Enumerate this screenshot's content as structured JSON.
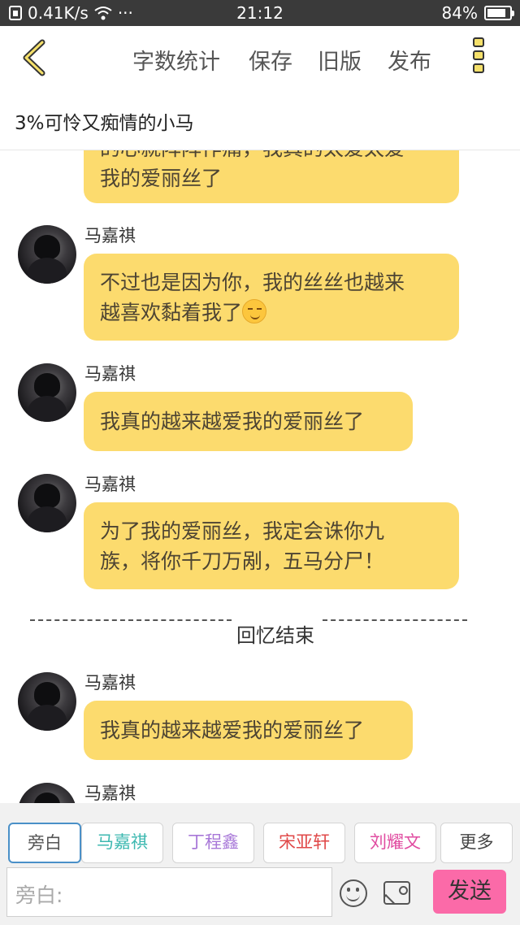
{
  "status_bar": {
    "speed": "0.41K/s",
    "extra": "···",
    "time": "21:12",
    "battery_text": "84%",
    "battery_level": 0.84
  },
  "top_bar": {
    "word_count_label": "字数统计",
    "save_label": "保存",
    "old_version_label": "旧版",
    "publish_label": "发布"
  },
  "story_title": "3%可怜又痴情的小马",
  "messages": [
    {
      "sender": "",
      "text": "的心就阵阵作痛，我真的太爱太爱我的爱丽丝了"
    },
    {
      "sender": "马嘉祺",
      "text": "不过也是因为你，我的丝丝也越来越喜欢黏着我了"
    },
    {
      "sender": "马嘉祺",
      "text": "我真的越来越爱我的爱丽丝了"
    },
    {
      "sender": "马嘉祺",
      "text": "为了我的爱丽丝，我定会诛你九族，将你千刀万剐，五马分尸！"
    },
    {
      "sender": "马嘉祺",
      "text": "我真的越来越爱我的爱丽丝了"
    },
    {
      "sender": "马嘉祺",
      "text": ""
    }
  ],
  "message_lines": {
    "m0_l1": "的心就阵阵作痛，我真的太爱太爱",
    "m0_l2": "我的爱丽丝了",
    "m1_l1": "不过也是因为你，我的丝丝也越来",
    "m1_l2": "越喜欢黏着我了",
    "m2_l1": "我真的越来越爱我的爱丽丝了",
    "m3_l1": "为了我的爱丽丝，我定会诛你九",
    "m3_l2": "族，将你千刀万剐，五马分尸！",
    "m4_l1": "我真的越来越爱我的爱丽丝了"
  },
  "divider_label": "回忆结束",
  "roles": [
    {
      "label": "旁白",
      "color": "#555555"
    },
    {
      "label": "马嘉祺",
      "color": "#3cb8b0"
    },
    {
      "label": "丁程鑫",
      "color": "#a878d8"
    },
    {
      "label": "宋亚轩",
      "color": "#e04848"
    },
    {
      "label": "刘耀文",
      "color": "#e04ba0"
    },
    {
      "label": "更多",
      "color": "#444444"
    }
  ],
  "input": {
    "placeholder": "旁白:"
  },
  "send_label": "发送",
  "colors": {
    "bubble": "#fcdb6e",
    "send": "#fb6aa8",
    "active_role_border": "#4a90c8"
  }
}
